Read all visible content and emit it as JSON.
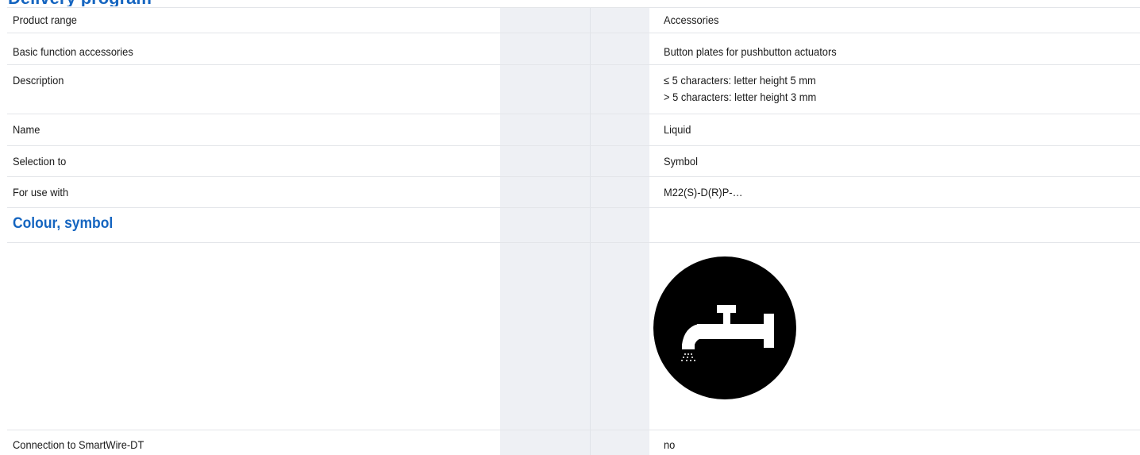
{
  "cut_heading": "Delivery program",
  "rows": [
    {
      "label": "Product range",
      "value": "Accessories"
    },
    {
      "label": "Basic function accessories",
      "value": "Button plates for pushbutton actuators"
    },
    {
      "label": "Description",
      "value_lines": [
        "≤ 5 characters: letter height 5 mm",
        "> 5 characters: letter height 3 mm"
      ]
    },
    {
      "label": "Name",
      "value": "Liquid"
    },
    {
      "label": "Selection to",
      "value": "Symbol"
    },
    {
      "label": "For use with",
      "value": "M22(S)-D(R)P-…"
    }
  ],
  "section": {
    "title": "Colour, symbol"
  },
  "symbol": {
    "icon": "liquid-tap-icon",
    "color": "#000000"
  },
  "last_row": {
    "label": "Connection to SmartWire-DT",
    "value": "no"
  },
  "colors": {
    "accent": "#1565c0",
    "column_shade": "#eef0f4",
    "rule": "#e3e5e9"
  }
}
